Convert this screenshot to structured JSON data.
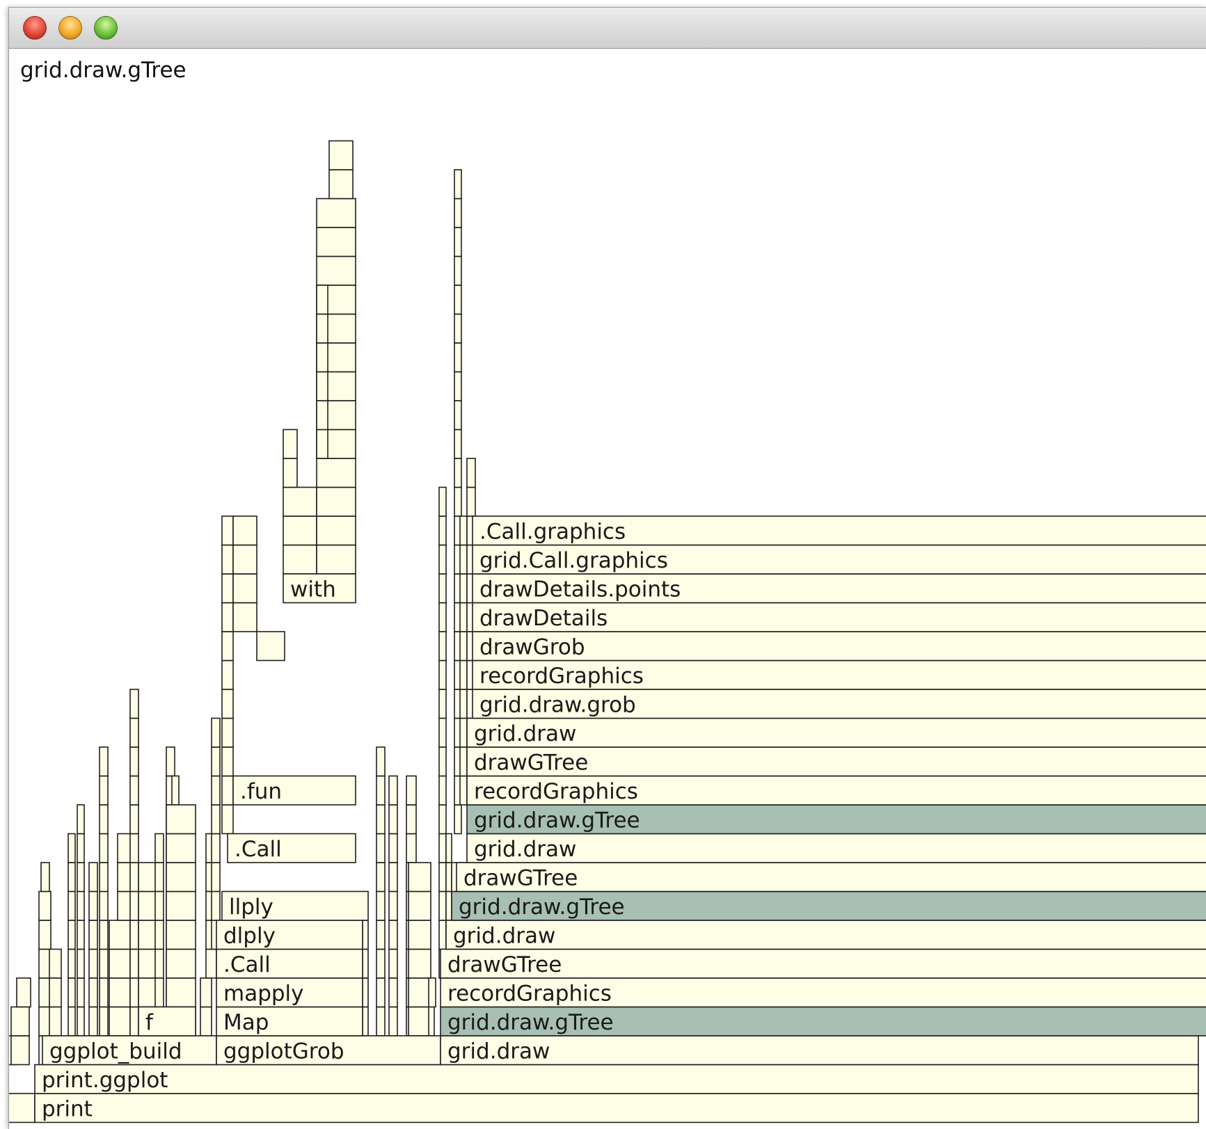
{
  "window": {
    "title_controls": [
      "close",
      "minimize",
      "zoom"
    ],
    "hover_label": "grid.draw.gTree"
  },
  "colors": {
    "frame_fill": "#fefde6",
    "highlight_fill": "#a8bfb4",
    "stroke": "#1f1f1f"
  },
  "flame": {
    "labels": [
      "print",
      "print.ggplot",
      "ggplot_build",
      "ggplotGrob",
      "grid.draw",
      "f",
      "Map",
      "grid.draw.gTree",
      "mapply",
      "recordGraphics",
      ".Call",
      "drawGTree",
      "dlply",
      "grid.draw",
      "llply",
      "grid.draw.gTree",
      "recordGraphics",
      "drawGTree",
      ".Call",
      "grid.draw",
      "grid.draw.gTree",
      ".fun",
      "recordGraphics",
      "drawGTree",
      "grid.draw",
      "grid.draw.grob",
      "recordGraphics",
      "drawGrob",
      "drawDetails",
      "drawDetails.points",
      "with",
      "grid.Call.graphics",
      ".Call.graphics"
    ]
  }
}
